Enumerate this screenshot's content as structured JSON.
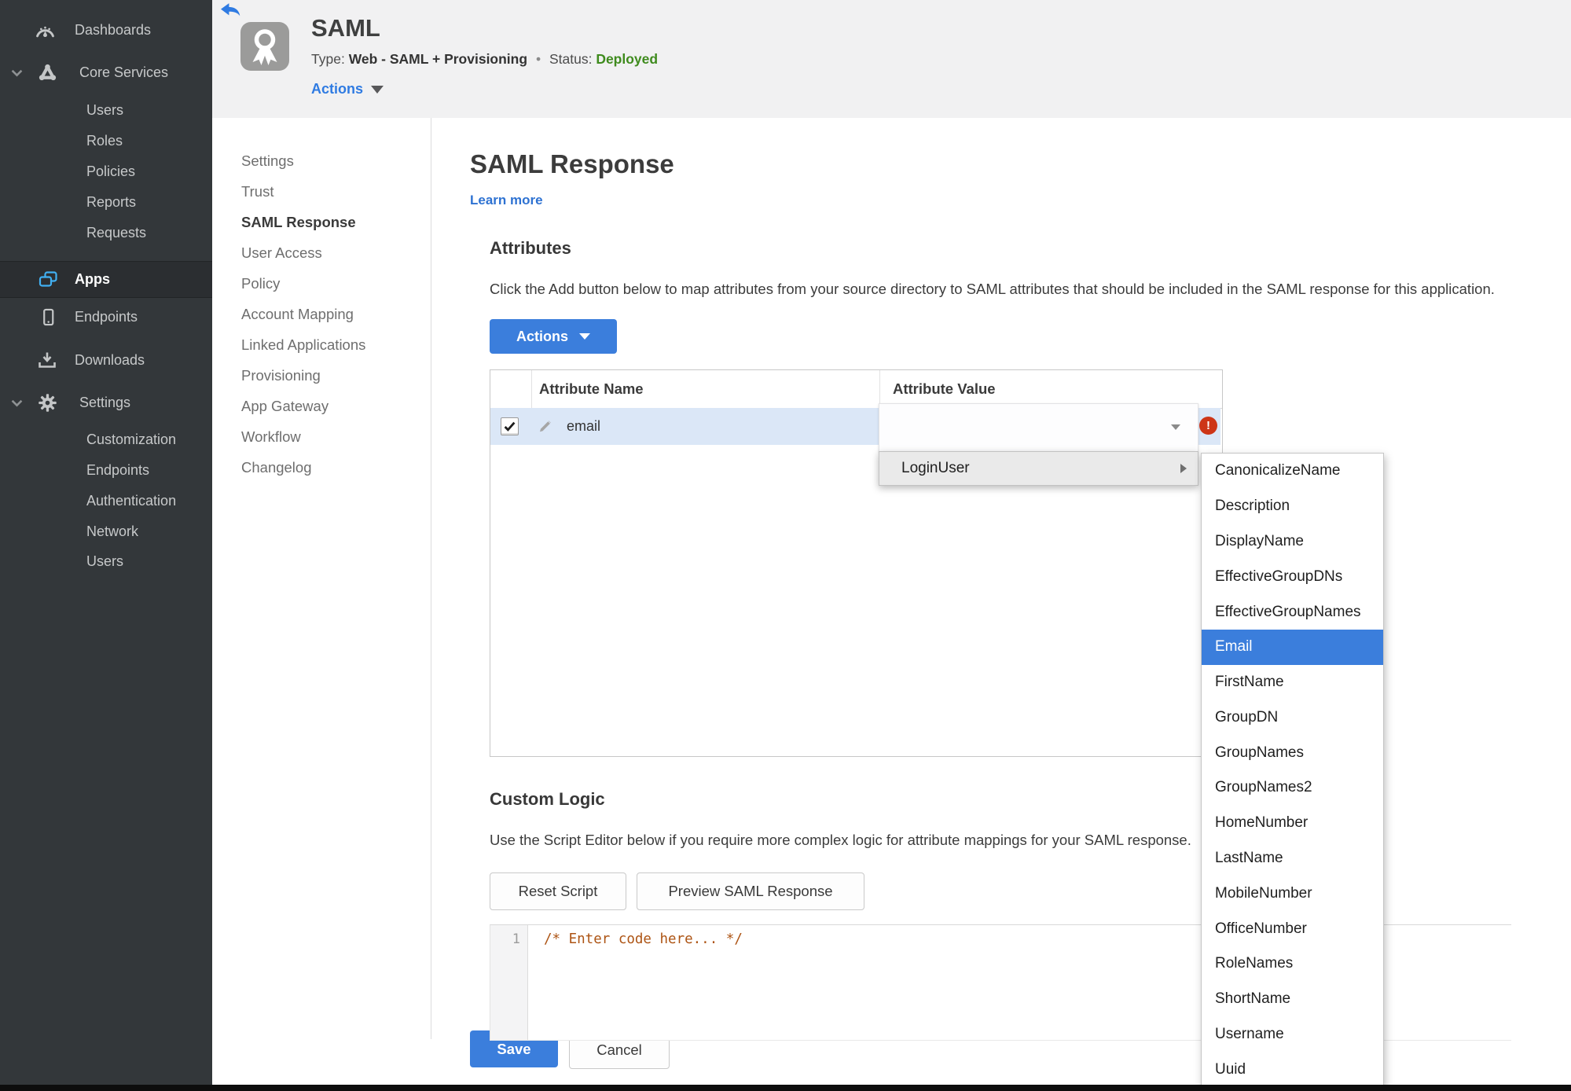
{
  "sidebar": {
    "items_top": [
      {
        "label": "Dashboards",
        "icon": "gauge-icon"
      },
      {
        "label": "Core Services",
        "icon": "core-services-icon",
        "expanded": true
      }
    ],
    "core_services_children": [
      "Users",
      "Roles",
      "Policies",
      "Reports",
      "Requests"
    ],
    "items_mid": [
      {
        "label": "Apps",
        "icon": "apps-icon",
        "active": true
      },
      {
        "label": "Endpoints",
        "icon": "endpoints-icon"
      },
      {
        "label": "Downloads",
        "icon": "downloads-icon"
      },
      {
        "label": "Settings",
        "icon": "gear-icon",
        "expanded": true
      }
    ],
    "settings_children": [
      "Customization",
      "Endpoints",
      "Authentication",
      "Network",
      "Users"
    ]
  },
  "header": {
    "title": "SAML",
    "type_label": "Type:",
    "type_value": "Web - SAML + Provisioning",
    "dot": "•",
    "status_label": "Status:",
    "status_value": "Deployed",
    "actions_label": "Actions"
  },
  "subnav": {
    "active": "SAML Response",
    "items": [
      "Settings",
      "Trust",
      "SAML Response",
      "User Access",
      "Policy",
      "Account Mapping",
      "Linked Applications",
      "Provisioning",
      "App Gateway",
      "Workflow",
      "Changelog"
    ]
  },
  "main": {
    "title": "SAML Response",
    "learn_more": "Learn more",
    "attributes": {
      "heading": "Attributes",
      "description": "Click the Add button below to map attributes from your source directory to SAML attributes that should be included in the SAML response for this application.",
      "actions_button": "Actions",
      "columns": [
        "Attribute Name",
        "Attribute Value"
      ],
      "rows": [
        {
          "name": "email",
          "value": "",
          "checked": true,
          "error": true
        }
      ]
    },
    "value_menu": {
      "root": "LoginUser",
      "selected": "Email",
      "options": [
        "CanonicalizeName",
        "Description",
        "DisplayName",
        "EffectiveGroupDNs",
        "EffectiveGroupNames",
        "Email",
        "FirstName",
        "GroupDN",
        "GroupNames",
        "GroupNames2",
        "HomeNumber",
        "LastName",
        "MobileNumber",
        "OfficeNumber",
        "RoleNames",
        "ShortName",
        "Username",
        "Uuid"
      ],
      "error_glyph": "!"
    },
    "custom_logic": {
      "heading": "Custom Logic",
      "description": "Use the Script Editor below if you require more complex logic for attribute mappings for your SAML response.",
      "reset_button": "Reset Script",
      "preview_button": "Preview SAML Response",
      "editor_line_number": "1",
      "editor_code": "/* Enter code here... */"
    },
    "save_button": "Save",
    "cancel_button": "Cancel"
  },
  "colors": {
    "accent_blue": "#3b7edc",
    "apps_icon_blue": "#41b0f2",
    "sidebar_bg": "#33373a",
    "topbar_bg": "#f1f1f2",
    "status_green": "#3f8b1e",
    "error_red": "#cd3517",
    "selected_row_blue": "#dbe7f7",
    "menu_gray": "#eaeaea",
    "code_comment_orange": "#ad5414"
  },
  "icons": [
    "back-arrow-icon",
    "app-badge-ribbon-icon",
    "gauge-icon",
    "core-services-icon",
    "apps-icon",
    "endpoints-icon",
    "downloads-icon",
    "gear-icon",
    "chevron-down-icon",
    "edit-pencil-icon",
    "dropdown-caret-icon",
    "submenu-arrow-icon",
    "error-exclamation-icon",
    "checkbox-check-icon"
  ]
}
